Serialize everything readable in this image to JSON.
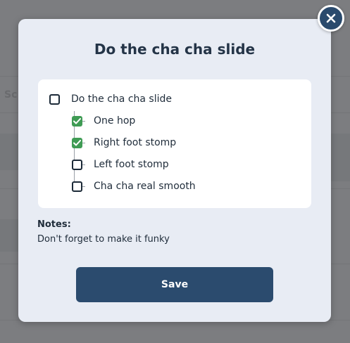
{
  "modal": {
    "title": "Do the cha cha slide",
    "close_icon": "close-icon",
    "checklist": {
      "parent": {
        "label": "Do the cha cha slide",
        "checked": false
      },
      "children": [
        {
          "label": "One hop",
          "checked": true
        },
        {
          "label": "Right foot stomp",
          "checked": true
        },
        {
          "label": "Left foot stomp",
          "checked": false
        },
        {
          "label": "Cha cha real smooth",
          "checked": false
        }
      ]
    },
    "notes_label": "Notes:",
    "notes_text": "Don't forget to make it funky",
    "save_label": "Save"
  },
  "background": {
    "partial_text": "Sc"
  },
  "colors": {
    "overlay": "#7f7f81",
    "modal_bg": "#e8ecf4",
    "primary": "#2b4b6e",
    "check_green": "#3f9b54",
    "text_dark": "#1f2c3a"
  }
}
